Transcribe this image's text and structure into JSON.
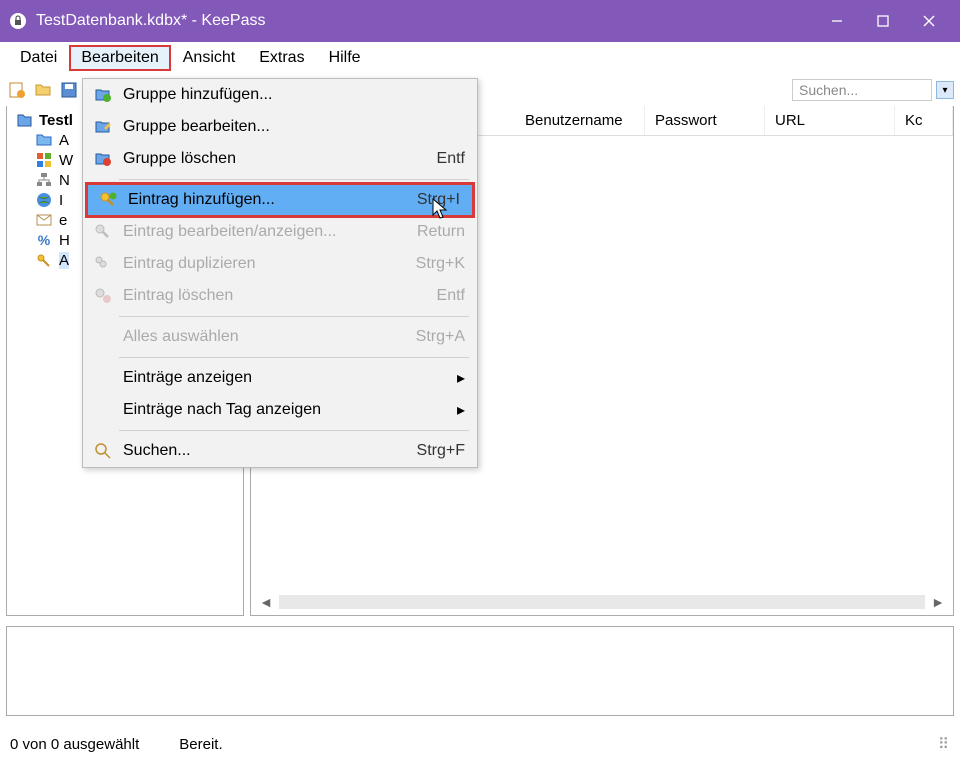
{
  "window": {
    "title": "TestDatenbank.kdbx* - KeePass"
  },
  "menubar": [
    "Datei",
    "Bearbeiten",
    "Ansicht",
    "Extras",
    "Hilfe"
  ],
  "menubar_active_index": 1,
  "toolbar": {
    "search_placeholder": "Suchen..."
  },
  "tree": {
    "root": "Testl",
    "items": [
      "A",
      "W",
      "N",
      "I",
      "e",
      "H",
      "A"
    ]
  },
  "list": {
    "columns": [
      "Benutzername",
      "Passwort",
      "URL",
      "Kc"
    ]
  },
  "dropdown": {
    "items": [
      {
        "label": "Gruppe hinzufügen...",
        "shortcut": "",
        "icon": "folder-plus-icon",
        "disabled": false
      },
      {
        "label": "Gruppe bearbeiten...",
        "shortcut": "",
        "icon": "folder-edit-icon",
        "disabled": false
      },
      {
        "label": "Gruppe löschen",
        "shortcut": "Entf",
        "icon": "folder-delete-icon",
        "disabled": false
      },
      {
        "sep": true
      },
      {
        "label": "Eintrag hinzufügen...",
        "shortcut": "Strg+I",
        "icon": "key-plus-icon",
        "disabled": false,
        "highlight": true
      },
      {
        "label": "Eintrag bearbeiten/anzeigen...",
        "shortcut": "Return",
        "icon": "key-edit-icon",
        "disabled": true
      },
      {
        "label": "Eintrag duplizieren",
        "shortcut": "Strg+K",
        "icon": "key-dup-icon",
        "disabled": true
      },
      {
        "label": "Eintrag löschen",
        "shortcut": "Entf",
        "icon": "key-delete-icon",
        "disabled": true
      },
      {
        "sep": true
      },
      {
        "label": "Alles auswählen",
        "shortcut": "Strg+A",
        "icon": "",
        "disabled": true
      },
      {
        "sep": true
      },
      {
        "label": "Einträge anzeigen",
        "shortcut": "",
        "icon": "",
        "disabled": false,
        "submenu": true
      },
      {
        "label": "Einträge nach Tag anzeigen",
        "shortcut": "",
        "icon": "",
        "disabled": false,
        "submenu": true
      },
      {
        "sep": true
      },
      {
        "label": "Suchen...",
        "shortcut": "Strg+F",
        "icon": "search-icon",
        "disabled": false
      }
    ]
  },
  "status": {
    "selection": "0 von 0 ausgewählt",
    "ready": "Bereit."
  }
}
